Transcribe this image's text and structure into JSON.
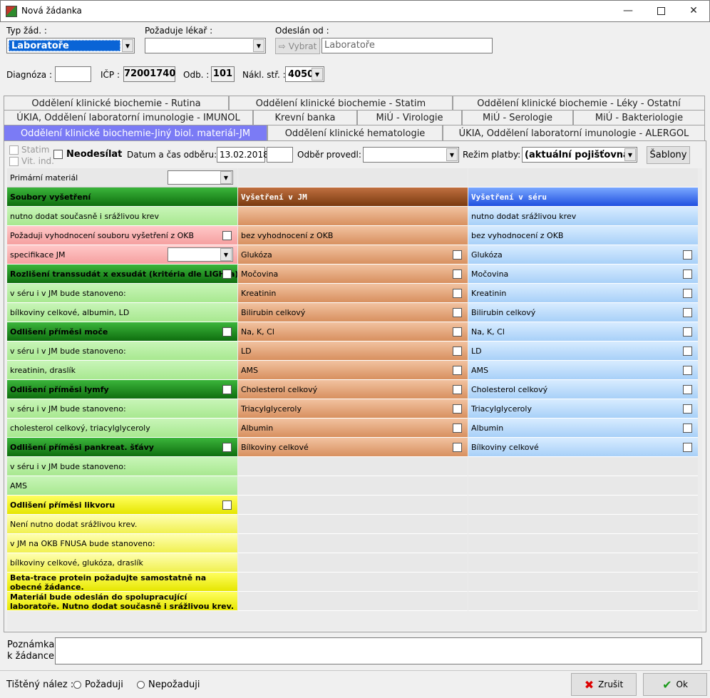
{
  "window": {
    "title": "Nová žádanka"
  },
  "header": {
    "typ_label": "Typ žád. :",
    "typ_value": "Laboratoře",
    "lekar_label": "Požaduje lékař :",
    "lekar_value": "",
    "odeslan_label": "Odeslán od :",
    "vybrat_label": "Vybrat",
    "odeslan_value": "Laboratoře",
    "diagnoza_label": "Diagnóza :",
    "diagnoza_value": "",
    "icp_label": "IČP :",
    "icp_value": "72001740",
    "odb_label": "Odb. :",
    "odb_value": "101",
    "nakl_label": "Nákl. stř. :",
    "nakl_value": "4050"
  },
  "tabs": {
    "row1": [
      "Oddělení klinické biochemie - Rutina",
      "Oddělení klinické biochemie - Statim",
      "Oddělení klinické biochemie - Léky - Ostatní"
    ],
    "row2": [
      "ÚKIA, Oddělení laboratorní imunologie - IMUNOL",
      "Krevní banka",
      "MiÚ - Virologie",
      "MiÚ - Serologie",
      "MiÚ - Bakteriologie"
    ],
    "row3": [
      "Oddělení klinické biochemie-Jiný biol. materiál-JM",
      "Oddělení klinické hematologie",
      "ÚKIA, Oddělení laboratorní imunologie - ALERGOL"
    ]
  },
  "options": {
    "statim": "Statim",
    "vit_ind": "Vit. ind.",
    "neodesilat": "Neodesílat",
    "datum_label": "Datum a čas odběru:",
    "datum_value": "13.02.2018",
    "cas_value": "",
    "odber_label": "Odběr provedl:",
    "odber_value": "",
    "rezim_label": "Režim platby:",
    "rezim_value": "(aktuální pojišťovna)",
    "sablony": "Šablony"
  },
  "primarni_label": "Primární materiál",
  "col1": [
    {
      "t": "Soubory vyšetření",
      "k": "gh-h"
    },
    {
      "t": "nutno dodat současně i srážlivou krev",
      "k": "g"
    },
    {
      "t": "Požaduji vyhodnocení souboru vyšetření z OKB",
      "k": "r",
      "c": 1
    },
    {
      "t": "specifikace JM",
      "k": "r",
      "s": 1
    },
    {
      "t": "Rozlišení transsudát x exsudát (kritéria dle LIGHTa)",
      "k": "gh-h",
      "c": 1
    },
    {
      "t": "v séru i v JM bude stanoveno:",
      "k": "g"
    },
    {
      "t": "bílkoviny celkové, albumin, LD",
      "k": "g"
    },
    {
      "t": "Odlišení příměsi moče",
      "k": "gh-h",
      "c": 1
    },
    {
      "t": "v séru i v JM bude stanoveno:",
      "k": "g"
    },
    {
      "t": "kreatinin, draslík",
      "k": "g"
    },
    {
      "t": "Odlišení příměsi lymfy",
      "k": "gh-h",
      "c": 1
    },
    {
      "t": "v séru i v JM bude stanoveno:",
      "k": "g"
    },
    {
      "t": "cholesterol celkový, triacylglyceroly",
      "k": "g"
    },
    {
      "t": "Odlišení příměsi pankreat. šťávy",
      "k": "gh-h",
      "c": 1
    },
    {
      "t": "v séru i v JM bude stanoveno:",
      "k": "g"
    },
    {
      "t": "AMS",
      "k": "g"
    },
    {
      "t": "Odlišení příměsi likvoru",
      "k": "yh",
      "c": 1
    },
    {
      "t": "Není nutno dodat srážlivou krev.",
      "k": "y"
    },
    {
      "t": "v JM na OKB FNUSA bude stanoveno:",
      "k": "y"
    },
    {
      "t": "bílkoviny celkové, glukóza, draslík",
      "k": "y"
    },
    {
      "t": "Beta-trace protein požadujte samostatně na obecné žádance.",
      "k": "yh"
    },
    {
      "t": "Materiál bude odeslán do spolupracující laboratoře. Nutno dodat současně i srážlivou krev.",
      "k": "yh"
    }
  ],
  "col2": [
    {
      "t": "Vyšetření v JM",
      "k": "oh"
    },
    {
      "t": "",
      "k": "o"
    },
    {
      "t": "bez vyhodnocení z OKB",
      "k": "o"
    },
    {
      "t": "Glukóza",
      "k": "o",
      "c": 1
    },
    {
      "t": "Močovina",
      "k": "o",
      "c": 1
    },
    {
      "t": "Kreatinin",
      "k": "o",
      "c": 1
    },
    {
      "t": "Bilirubin celkový",
      "k": "o",
      "c": 1
    },
    {
      "t": "Na, K, Cl",
      "k": "o",
      "c": 1
    },
    {
      "t": "LD",
      "k": "o",
      "c": 1
    },
    {
      "t": "AMS",
      "k": "o",
      "c": 1
    },
    {
      "t": "Cholesterol celkový",
      "k": "o",
      "c": 1
    },
    {
      "t": "Triacylglyceroly",
      "k": "o",
      "c": 1
    },
    {
      "t": "Albumin",
      "k": "o",
      "c": 1
    },
    {
      "t": "Bílkoviny celkové",
      "k": "o",
      "c": 1
    }
  ],
  "col3": [
    {
      "t": "Vyšetření v séru",
      "k": "bh"
    },
    {
      "t": "nutno dodat srážlivou krev",
      "k": "b"
    },
    {
      "t": "bez vyhodnocení z OKB",
      "k": "b"
    },
    {
      "t": "Glukóza",
      "k": "b",
      "c": 1
    },
    {
      "t": "Močovina",
      "k": "b",
      "c": 1
    },
    {
      "t": "Kreatinin",
      "k": "b",
      "c": 1
    },
    {
      "t": "Bilirubin celkový",
      "k": "b",
      "c": 1
    },
    {
      "t": "Na, K, Cl",
      "k": "b",
      "c": 1
    },
    {
      "t": "LD",
      "k": "b",
      "c": 1
    },
    {
      "t": "AMS",
      "k": "b",
      "c": 1
    },
    {
      "t": "Cholesterol celkový",
      "k": "b",
      "c": 1
    },
    {
      "t": "Triacylglyceroly",
      "k": "b",
      "c": 1
    },
    {
      "t": "Albumin",
      "k": "b",
      "c": 1
    },
    {
      "t": "Bílkoviny celkové",
      "k": "b",
      "c": 1
    }
  ],
  "note": {
    "label1": "Poznámka",
    "label2": "k žádance",
    "value": ""
  },
  "footer": {
    "tisteny_label": "Tištěný nález :",
    "pozaduji": "Požaduji",
    "nepozaduji": "Nepožaduji",
    "zrusit": "Zrušit",
    "ok": "Ok"
  }
}
